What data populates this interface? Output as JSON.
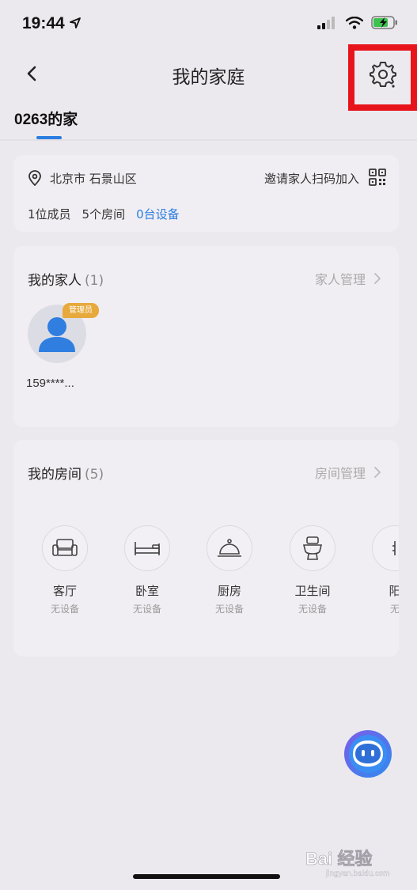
{
  "status_bar": {
    "time": "19:44"
  },
  "nav": {
    "title": "我的家庭"
  },
  "home_tabs": [
    {
      "label": "0263的家"
    }
  ],
  "info_card": {
    "location": "北京市 石景山区",
    "invite": "邀请家人扫码加入",
    "members": "1位成员",
    "rooms": "5个房间",
    "devices": "0台设备"
  },
  "family": {
    "title": "我的家人",
    "count": "(1)",
    "manage": "家人管理",
    "members": [
      {
        "name": "159****...",
        "badge": "管理员"
      }
    ]
  },
  "rooms": {
    "title": "我的房间",
    "count": "(5)",
    "manage": "房间管理",
    "items": [
      {
        "name": "客厅",
        "status": "无设备",
        "icon": "sofa-icon"
      },
      {
        "name": "卧室",
        "status": "无设备",
        "icon": "bed-icon"
      },
      {
        "name": "厨房",
        "status": "无设备",
        "icon": "cloche-icon"
      },
      {
        "name": "卫生间",
        "status": "无设备",
        "icon": "toilet-icon"
      },
      {
        "name": "阳",
        "status": "无",
        "icon": "partial-room-icon"
      }
    ]
  },
  "watermark": {
    "text": "Bai 经验",
    "subtext": "jingyan.baidu.com"
  },
  "colors": {
    "accent": "#2b7de0",
    "highlight_box": "#e8141c",
    "badge": "#e7a93b"
  }
}
